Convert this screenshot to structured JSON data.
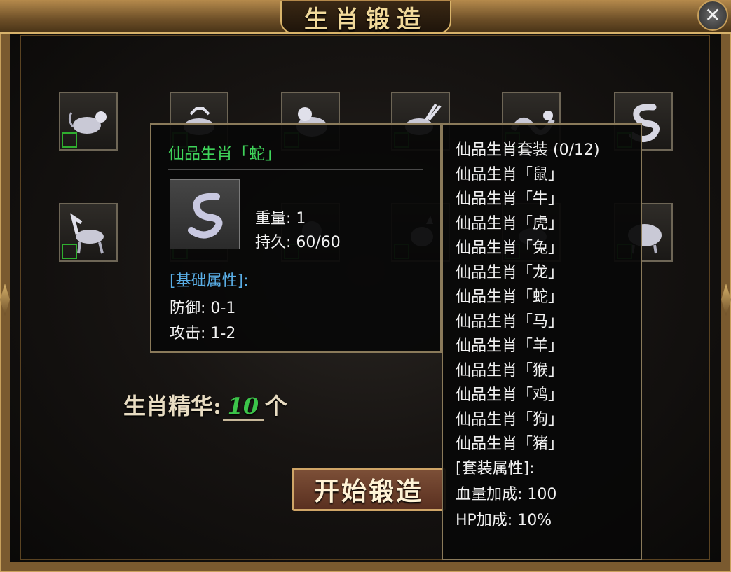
{
  "window": {
    "title": "生肖锻造",
    "close_symbol": "✕"
  },
  "slots": [
    {
      "animal_icon": "rat-icon"
    },
    {
      "animal_icon": "ox-icon"
    },
    {
      "animal_icon": "tiger-icon"
    },
    {
      "animal_icon": "rabbit-icon"
    },
    {
      "animal_icon": "dragon-icon"
    },
    {
      "animal_icon": "snake-icon"
    },
    {
      "animal_icon": "horse-icon"
    },
    {
      "animal_icon": "goat-icon"
    },
    {
      "animal_icon": "monkey-icon"
    },
    {
      "animal_icon": "rooster-icon"
    },
    {
      "animal_icon": "dog-icon"
    },
    {
      "animal_icon": "pig-icon"
    }
  ],
  "essence": {
    "label": "生肖精华:",
    "count": "10",
    "unit": "个"
  },
  "forge_button": "开始锻造",
  "item_tooltip": {
    "name": "仙品生肖「蛇」",
    "icon": "snake-icon",
    "weight": "重量: 1",
    "durability": "持久: 60/60",
    "base_attr_title": "[基础属性]:",
    "defense": "防御: 0-1",
    "attack": "攻击: 1-2"
  },
  "set_tooltip": {
    "title": "仙品生肖套装 (0/12)",
    "members": [
      "仙品生肖「鼠」",
      "仙品生肖「牛」",
      "仙品生肖「虎」",
      "仙品生肖「兔」",
      "仙品生肖「龙」",
      "仙品生肖「蛇」",
      "仙品生肖「马」",
      "仙品生肖「羊」",
      "仙品生肖「猴」",
      "仙品生肖「鸡」",
      "仙品生肖「狗」",
      "仙品生肖「猪」"
    ],
    "attr_title": "[套装属性]:",
    "bonus_1": "血量加成: 100",
    "bonus_2": "HP加成: 10%"
  },
  "colors": {
    "frame_gold": "#c9a15c",
    "item_name_green": "#3fd35a",
    "attr_title_blue": "#5aaee6",
    "essence_green": "#3cc44a"
  }
}
